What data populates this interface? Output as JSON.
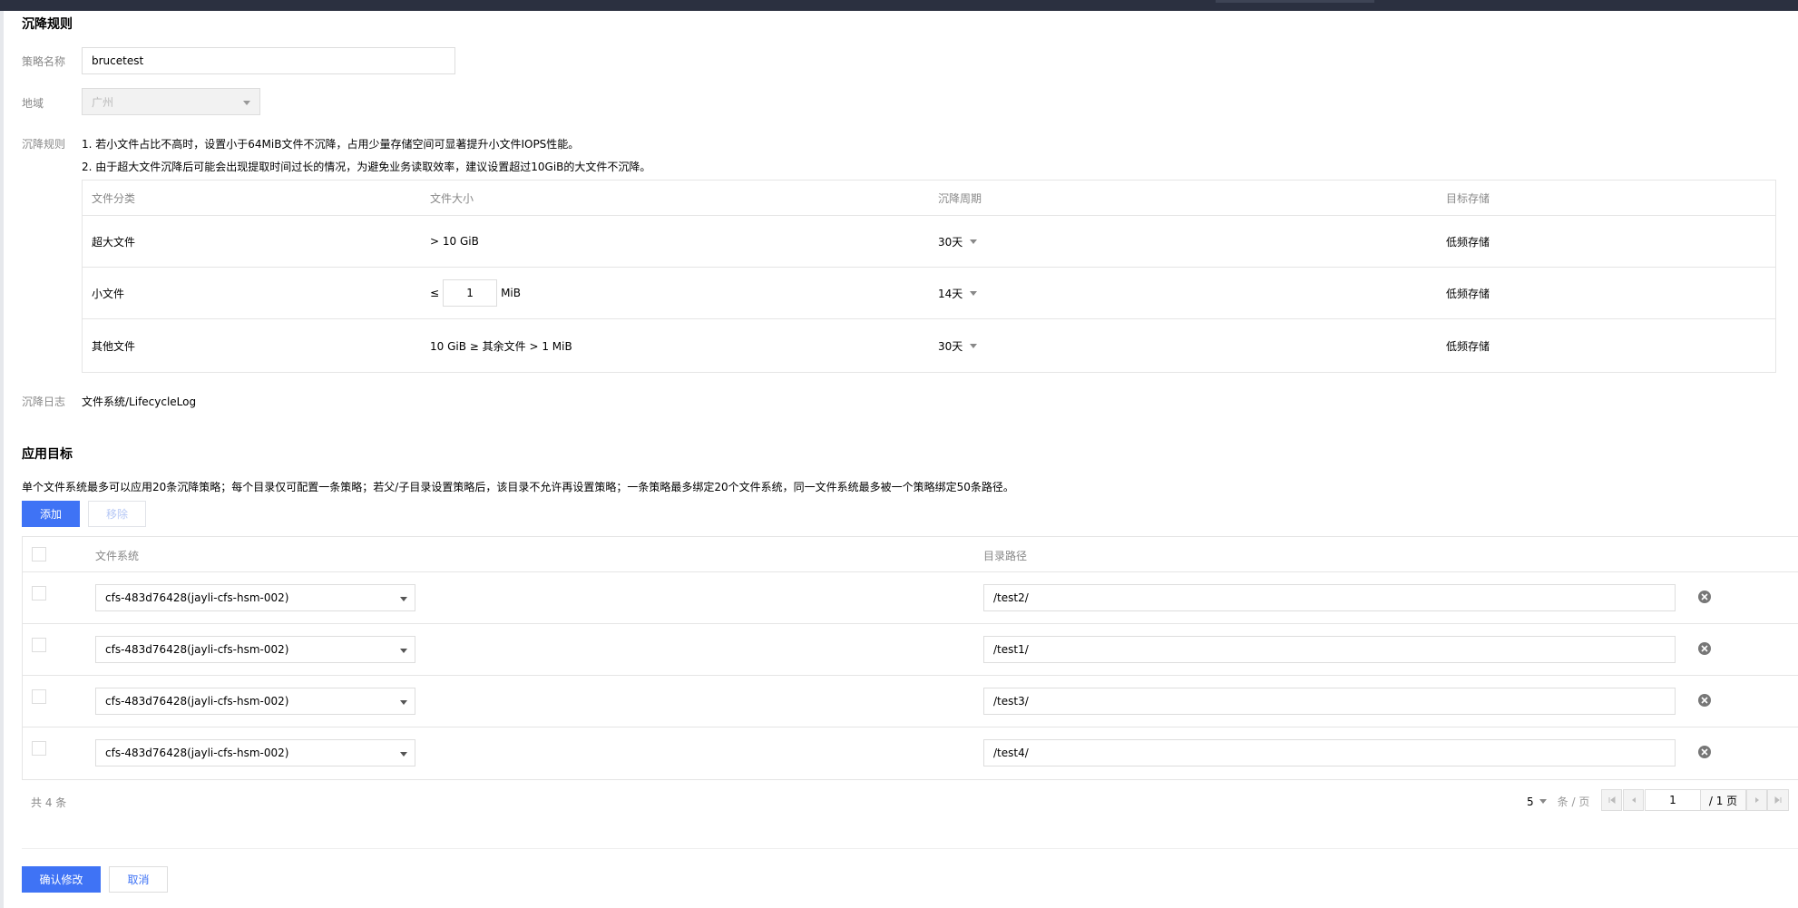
{
  "sections": {
    "rules_title": "沉降规则",
    "targets_title": "应用目标"
  },
  "form": {
    "policy_name_label": "策略名称",
    "policy_name_value": "brucetest",
    "region_label": "地域",
    "region_value": "广州",
    "rules_label": "沉降规则",
    "note1": "1. 若小文件占比不高时，设置小于64MiB文件不沉降，占用少量存储空间可显著提升小文件IOPS性能。",
    "note2": "2. 由于超大文件沉降后可能会出现提取时间过长的情况，为避免业务读取效率，建议设置超过10GiB的大文件不沉降。",
    "log_label": "沉降日志",
    "log_value": "文件系统/LifecycleLog"
  },
  "rules_table": {
    "headers": [
      "文件分类",
      "文件大小",
      "沉降周期",
      "目标存储"
    ],
    "rows": [
      {
        "category": "超大文件",
        "size": "> 10 GiB",
        "period": "30天",
        "storage": "低频存储"
      },
      {
        "category": "小文件",
        "size_prefix": "≤",
        "size_value": "1",
        "size_unit": "MiB",
        "period": "14天",
        "storage": "低频存储"
      },
      {
        "category": "其他文件",
        "size": "10 GiB ≥ 其余文件 > 1 MiB",
        "period": "30天",
        "storage": "低频存储"
      }
    ]
  },
  "targets": {
    "description": "单个文件系统最多可以应用20条沉降策略；每个目录仅可配置一条策略；若父/子目录设置策略后，该目录不允许再设置策略；一条策略最多绑定20个文件系统，同一文件系统最多被一个策略绑定50条路径。",
    "add_label": "添加",
    "remove_label": "移除",
    "headers": {
      "fs": "文件系统",
      "path": "目录路径"
    },
    "rows": [
      {
        "fs": "cfs-483d76428(jayli-cfs-hsm-002)",
        "path": "/test2/"
      },
      {
        "fs": "cfs-483d76428(jayli-cfs-hsm-002)",
        "path": "/test1/"
      },
      {
        "fs": "cfs-483d76428(jayli-cfs-hsm-002)",
        "path": "/test3/"
      },
      {
        "fs": "cfs-483d76428(jayli-cfs-hsm-002)",
        "path": "/test4/"
      }
    ]
  },
  "pagination": {
    "total": "共 4 条",
    "page_size": "5",
    "page_size_unit": "条 / 页",
    "current_page": "1",
    "total_pages": "/ 1 页"
  },
  "actions": {
    "confirm_label": "确认修改",
    "cancel_label": "取消"
  },
  "colors": {
    "primary": "#3f73f5",
    "topbar": "#2b3040"
  }
}
